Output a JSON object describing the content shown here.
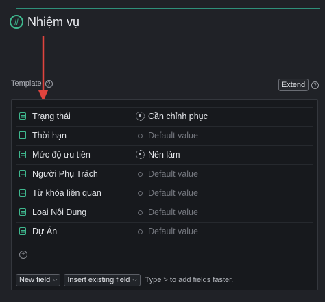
{
  "header": {
    "icon": "hash-icon",
    "title": "Nhiệm vụ",
    "accent_color": "#3fb88e"
  },
  "template": {
    "label": "Template",
    "extend_label": "Extend"
  },
  "annotation": {
    "icon": "red-arrow-down-icon",
    "color": "#e0443e"
  },
  "fields": [
    {
      "icon": "document-icon",
      "name": "Trạng thái",
      "value_icon": "status-gear-icon",
      "value": "Cần chỉnh phục",
      "has_value": true
    },
    {
      "icon": "calendar-icon",
      "name": "Thời hạn",
      "value_icon": "empty-circle-icon",
      "value": "Default value",
      "has_value": false
    },
    {
      "icon": "document-icon",
      "name": "Mức độ ưu tiên",
      "value_icon": "status-gear-icon",
      "value": "Nên làm",
      "has_value": true
    },
    {
      "icon": "document-icon",
      "name": "Người Phụ Trách",
      "value_icon": "empty-circle-icon",
      "value": "Default value",
      "has_value": false
    },
    {
      "icon": "document-icon",
      "name": "Từ khóa liên quan",
      "value_icon": "empty-circle-icon",
      "value": "Default value",
      "has_value": false
    },
    {
      "icon": "document-icon",
      "name": "Loại Nội Dung",
      "value_icon": "empty-circle-icon",
      "value": "Default value",
      "has_value": false
    },
    {
      "icon": "document-icon",
      "name": "Dự Án",
      "value_icon": "empty-circle-icon",
      "value": "Default value",
      "has_value": false
    }
  ],
  "footer": {
    "new_field_label": "New field",
    "insert_existing_label": "Insert existing field",
    "hint": "Type > to add fields faster."
  }
}
